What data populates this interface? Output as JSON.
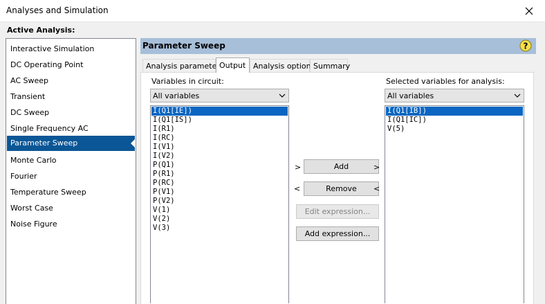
{
  "window": {
    "title": "Analyses and Simulation",
    "close_icon": "close-icon"
  },
  "active_analysis_label": "Active Analysis:",
  "analyses": [
    {
      "label": "Interactive Simulation"
    },
    {
      "label": "DC Operating Point"
    },
    {
      "label": "AC Sweep"
    },
    {
      "label": "Transient"
    },
    {
      "label": "DC Sweep"
    },
    {
      "label": "Single Frequency AC"
    },
    {
      "label": "Parameter Sweep",
      "selected": true
    },
    {
      "label": "Monte Carlo"
    },
    {
      "label": "Fourier"
    },
    {
      "label": "Temperature Sweep"
    },
    {
      "label": "Worst Case"
    },
    {
      "label": "Noise Figure"
    }
  ],
  "panel": {
    "title": "Parameter Sweep",
    "help_icon": "help-icon"
  },
  "tabs": [
    {
      "label": "Analysis parameters"
    },
    {
      "label": "Output",
      "active": true
    },
    {
      "label": "Analysis options"
    },
    {
      "label": "Summary"
    }
  ],
  "output": {
    "variables_label": "Variables in circuit:",
    "variables_filter": "All variables",
    "variables": [
      "I(Q1[IE])",
      "I(Q1[IS])",
      "I(R1)",
      "I(RC)",
      "I(V1)",
      "I(V2)",
      "P(Q1)",
      "P(R1)",
      "P(RC)",
      "P(V1)",
      "P(V2)",
      "V(1)",
      "V(2)",
      "V(3)"
    ],
    "variables_selected_index": 0,
    "selected_label": "Selected variables for analysis:",
    "selected_filter": "All variables",
    "selected": [
      "I(Q1[IB])",
      "I(Q1[IC])",
      "V(5)"
    ],
    "selected_selected_index": 0,
    "buttons": {
      "add": "Add",
      "remove": "Remove",
      "edit_expression": "Edit expression...",
      "add_expression": "Add expression..."
    },
    "arrows": {
      "right": ">",
      "left": "<"
    }
  },
  "colors": {
    "selection": "#0a5696",
    "panel_header": "#a7bfd9"
  }
}
